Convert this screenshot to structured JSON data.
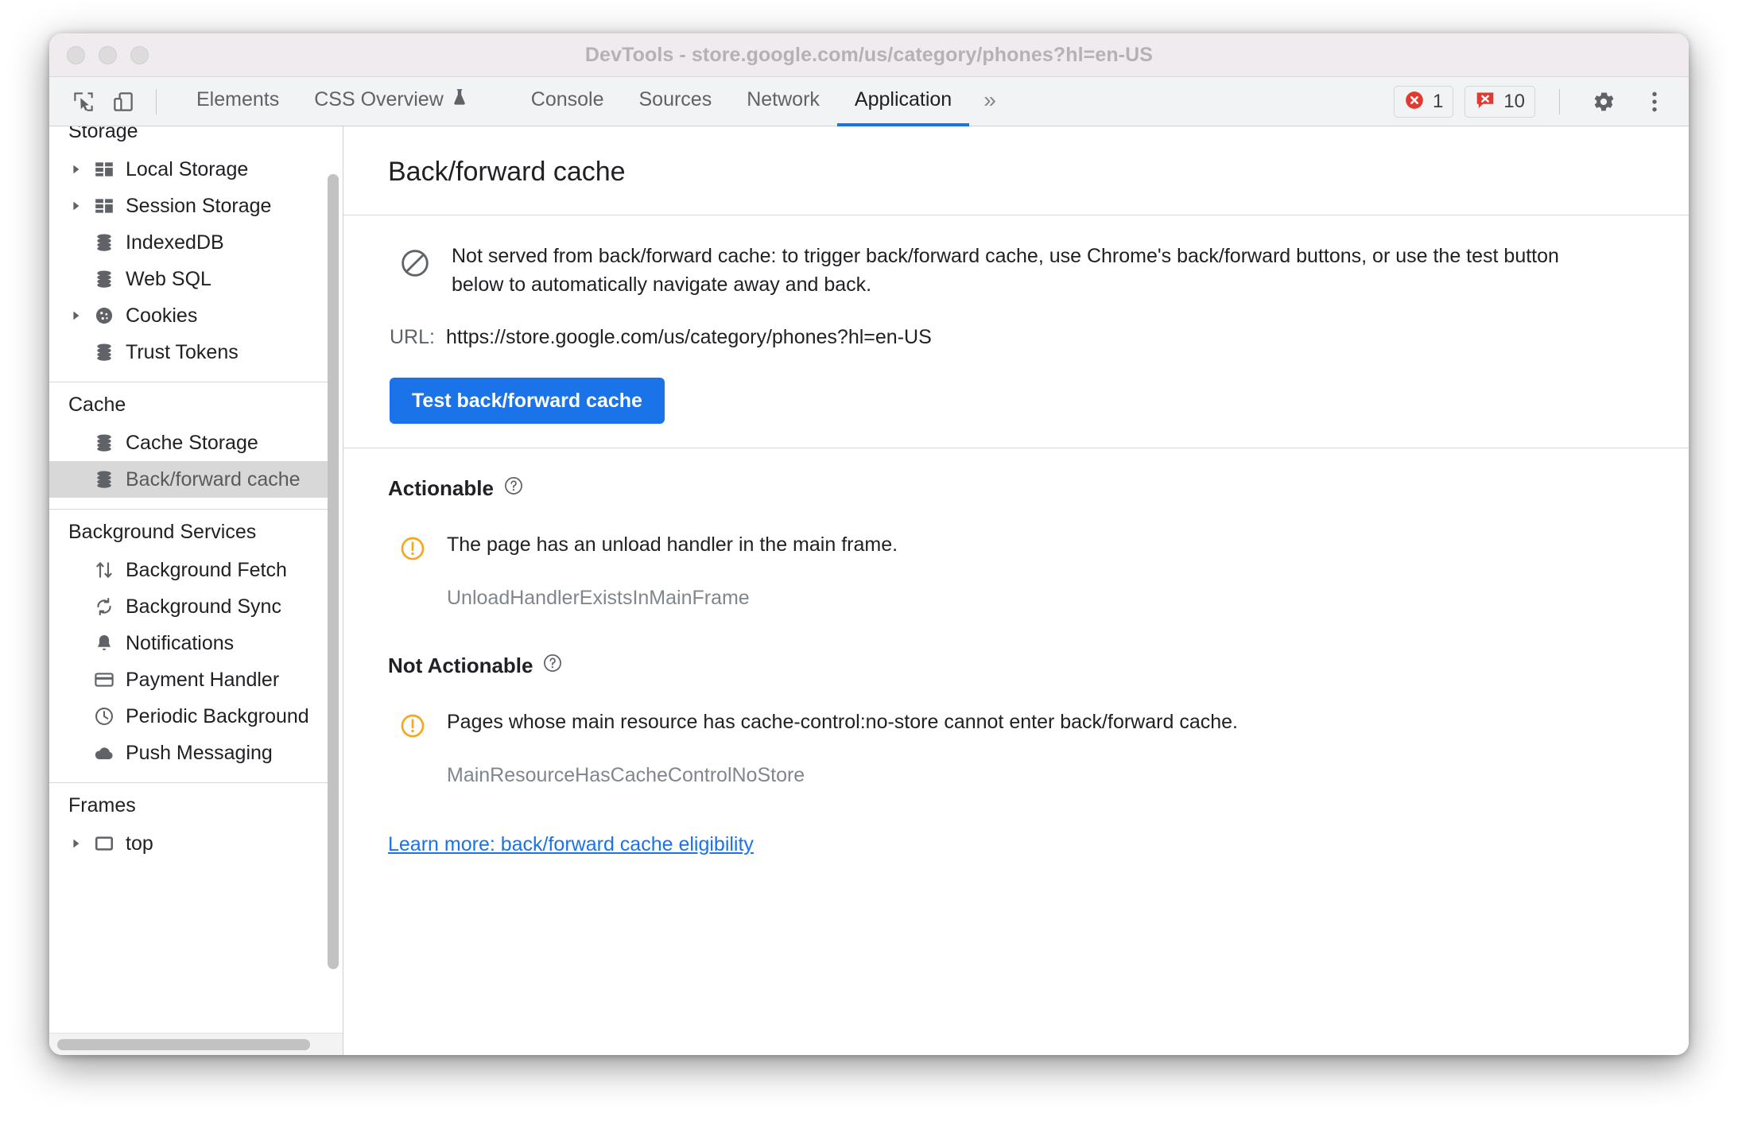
{
  "window": {
    "title": "DevTools - store.google.com/us/category/phones?hl=en-US",
    "traffic_lights": [
      "close",
      "minimize",
      "maximize"
    ]
  },
  "toolbar": {
    "inspect_icon": "inspect-element-icon",
    "device_icon": "device-toolbar-icon",
    "tabs": [
      {
        "label": "Elements",
        "active": false,
        "icon": null
      },
      {
        "label": "CSS Overview",
        "active": false,
        "icon": "experiment-flask-icon"
      },
      {
        "label": "Console",
        "active": false,
        "icon": null
      },
      {
        "label": "Sources",
        "active": false,
        "icon": null
      },
      {
        "label": "Network",
        "active": false,
        "icon": null
      },
      {
        "label": "Application",
        "active": true,
        "icon": null
      }
    ],
    "more_tabs_label": "»",
    "errors_count": "1",
    "issues_count": "10",
    "settings_icon": "gear-icon",
    "menu_icon": "kebab-menu-icon",
    "accent_color": "#1a73e8",
    "error_color": "#e13b2f"
  },
  "sidebar": {
    "groups": [
      {
        "header": "Storage",
        "header_clipped": true,
        "items": [
          {
            "label": "Local Storage",
            "icon": "table-grid-icon",
            "expandable": true,
            "selected": false
          },
          {
            "label": "Session Storage",
            "icon": "table-grid-icon",
            "expandable": true,
            "selected": false
          },
          {
            "label": "IndexedDB",
            "icon": "database-icon",
            "expandable": false,
            "selected": false
          },
          {
            "label": "Web SQL",
            "icon": "database-icon",
            "expandable": false,
            "selected": false
          },
          {
            "label": "Cookies",
            "icon": "cookie-icon",
            "expandable": true,
            "selected": false
          },
          {
            "label": "Trust Tokens",
            "icon": "database-icon",
            "expandable": false,
            "selected": false
          }
        ]
      },
      {
        "header": "Cache",
        "header_clipped": false,
        "items": [
          {
            "label": "Cache Storage",
            "icon": "database-icon",
            "expandable": false,
            "selected": false
          },
          {
            "label": "Back/forward cache",
            "icon": "database-icon",
            "expandable": false,
            "selected": true
          }
        ]
      },
      {
        "header": "Background Services",
        "header_clipped": false,
        "items": [
          {
            "label": "Background Fetch",
            "icon": "transfer-arrows-icon",
            "expandable": false,
            "selected": false
          },
          {
            "label": "Background Sync",
            "icon": "sync-icon",
            "expandable": false,
            "selected": false
          },
          {
            "label": "Notifications",
            "icon": "bell-icon",
            "expandable": false,
            "selected": false
          },
          {
            "label": "Payment Handler",
            "icon": "credit-card-icon",
            "expandable": false,
            "selected": false
          },
          {
            "label": "Periodic Background",
            "icon": "clock-icon",
            "expandable": false,
            "selected": false
          },
          {
            "label": "Push Messaging",
            "icon": "cloud-icon",
            "expandable": false,
            "selected": false
          }
        ]
      },
      {
        "header": "Frames",
        "header_clipped": false,
        "items": [
          {
            "label": "top",
            "icon": "frame-icon",
            "expandable": true,
            "selected": false
          }
        ]
      }
    ]
  },
  "main": {
    "panel_title": "Back/forward cache",
    "status": {
      "icon": "blocked-circle-slash-icon",
      "message": "Not served from back/forward cache: to trigger back/forward cache, use Chrome's back/forward buttons, or use the test button below to automatically navigate away and back."
    },
    "url_label": "URL:",
    "url_value": "https://store.google.com/us/category/phones?hl=en-US",
    "test_button_label": "Test back/forward cache",
    "sections": [
      {
        "heading": "Actionable",
        "help_icon": "help-circle-icon",
        "issues": [
          {
            "icon": "warning-circle-icon",
            "text": "The page has an unload handler in the main frame.",
            "code": "UnloadHandlerExistsInMainFrame"
          }
        ]
      },
      {
        "heading": "Not Actionable",
        "help_icon": "help-circle-icon",
        "issues": [
          {
            "icon": "warning-circle-icon",
            "text": "Pages whose main resource has cache-control:no-store cannot enter back/forward cache.",
            "code": "MainResourceHasCacheControlNoStore"
          }
        ]
      }
    ],
    "learn_more_label": "Learn more: back/forward cache eligibility",
    "warning_color": "#f5a623",
    "link_color": "#1a73e8"
  }
}
